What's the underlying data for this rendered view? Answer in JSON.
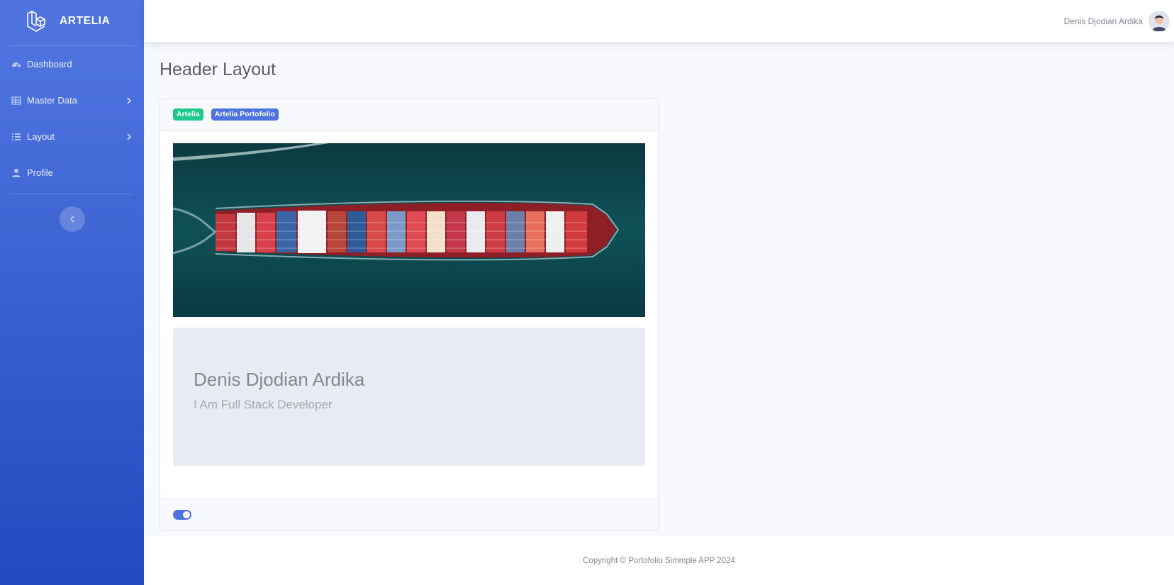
{
  "brand": {
    "name": "ARTELIA",
    "icon": "laravel-logo-icon"
  },
  "sidebar": {
    "items": [
      {
        "label": "Dashboard",
        "icon": "gauge-icon",
        "has_submenu": false
      },
      {
        "label": "Master Data",
        "icon": "table-icon",
        "has_submenu": true
      },
      {
        "label": "Layout",
        "icon": "list-icon",
        "has_submenu": true
      },
      {
        "label": "Profile",
        "icon": "user-icon",
        "has_submenu": false
      }
    ],
    "toggle_icon": "chevron-left-icon"
  },
  "topbar": {
    "user_name": "Denis Djodian Ardika",
    "avatar_icon": "avatar"
  },
  "page": {
    "title": "Header Layout"
  },
  "card": {
    "badges": [
      {
        "label": "Artelia",
        "color": "#1cc88a"
      },
      {
        "label": "Artelia Portofolio",
        "color": "#4e73df"
      }
    ],
    "banner_image": "container-ship-aerial-image",
    "jumbotron": {
      "title": "Denis Djodian Ardika",
      "subtitle": "I Am Full Stack Developer"
    },
    "footer_switch": {
      "checked": true
    }
  },
  "footer": {
    "copyright": "Copyright © Portofolio Simmple APP 2024"
  },
  "colors": {
    "primary": "#4e73df",
    "success": "#1cc88a",
    "sidebar_dark": "#224abe"
  }
}
